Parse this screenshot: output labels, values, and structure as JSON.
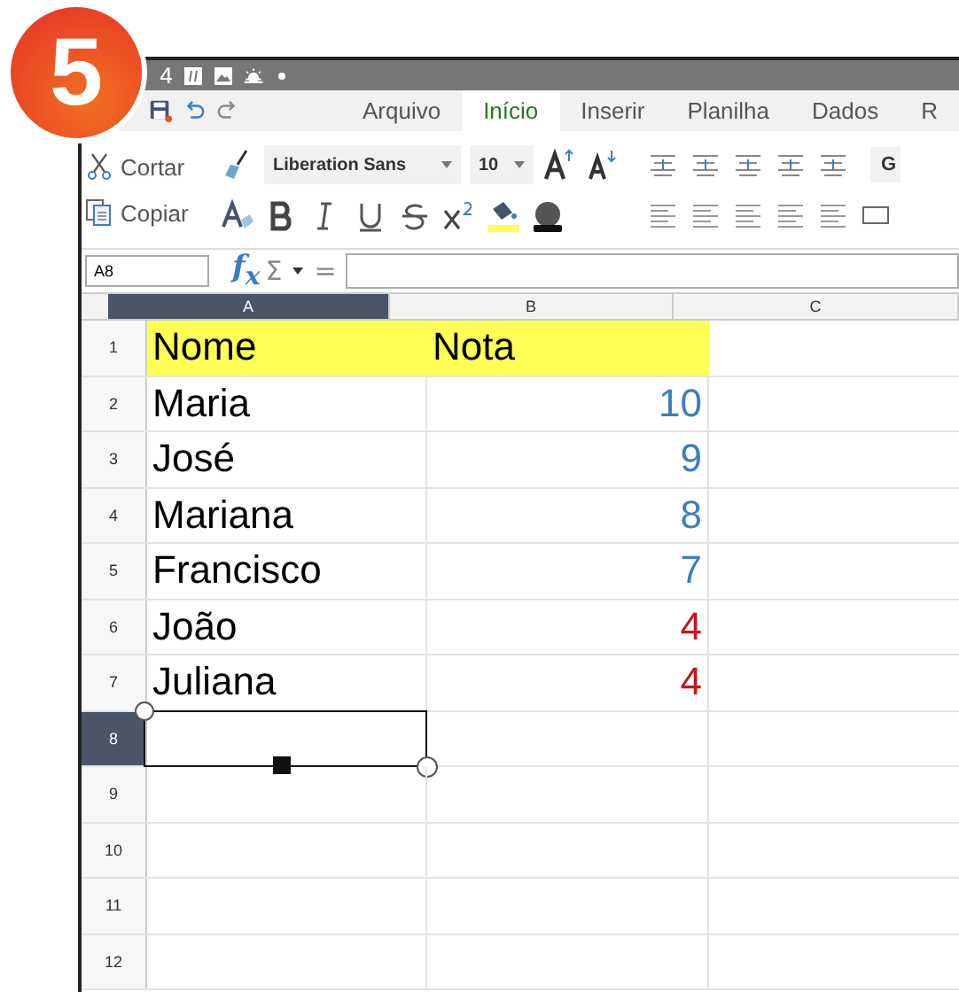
{
  "badge": {
    "text": "5"
  },
  "status_bar": {
    "text": "4"
  },
  "tabs": [
    {
      "label": "Arquivo",
      "selected": false
    },
    {
      "label": "Início",
      "selected": true
    },
    {
      "label": "Inserir",
      "selected": false
    },
    {
      "label": "Planilha",
      "selected": false
    },
    {
      "label": "Dados",
      "selected": false
    },
    {
      "label": "R",
      "selected": false
    }
  ],
  "toolbar": {
    "cut": "Cortar",
    "copy": "Copiar",
    "font": "Liberation Sans",
    "size": "10",
    "style_box": "G"
  },
  "formula_bar": {
    "name_box": "A8",
    "function": "f$_{x}$",
    "sum": "Σ",
    "equals": "="
  },
  "columns": [
    {
      "label": "A",
      "selected": true
    },
    {
      "label": "B",
      "selected": false
    },
    {
      "label": "C",
      "selected": false
    }
  ],
  "rows": [
    {
      "number": "1",
      "selected": false,
      "highlighted": true,
      "cells": [
        {
          "kind": "text",
          "text": "Nome"
        },
        {
          "kind": "text",
          "text": "Nota"
        }
      ]
    },
    {
      "number": "2",
      "selected": false,
      "highlighted": false,
      "cells": [
        {
          "kind": "text",
          "text": "Maria"
        },
        {
          "kind": "number",
          "text": "10",
          "color": "#3b7dc1"
        }
      ]
    },
    {
      "number": "3",
      "selected": false,
      "highlighted": false,
      "cells": [
        {
          "kind": "text",
          "text": "José"
        },
        {
          "kind": "number",
          "text": "9",
          "color": "#3b7dc1"
        }
      ]
    },
    {
      "number": "4",
      "selected": false,
      "highlighted": false,
      "cells": [
        {
          "kind": "text",
          "text": "Mariana"
        },
        {
          "kind": "number",
          "text": "8",
          "color": "#3b7dc1"
        }
      ]
    },
    {
      "number": "5",
      "selected": false,
      "highlighted": false,
      "cells": [
        {
          "kind": "text",
          "text": "Francisco"
        },
        {
          "kind": "number",
          "text": "7",
          "color": "#3b7dc1"
        }
      ]
    },
    {
      "number": "6",
      "selected": false,
      "highlighted": false,
      "cells": [
        {
          "kind": "text",
          "text": "João"
        },
        {
          "kind": "number",
          "text": "4",
          "color": "#c4161c"
        }
      ]
    },
    {
      "number": "7",
      "selected": false,
      "highlighted": false,
      "cells": [
        {
          "kind": "text",
          "text": "Juliana"
        },
        {
          "kind": "number",
          "text": "4",
          "color": "#c4161c"
        }
      ]
    },
    {
      "number": "8",
      "selected": true,
      "highlighted": false
    },
    {
      "number": "9",
      "selected": false,
      "highlighted": false
    },
    {
      "number": "10",
      "selected": false,
      "highlighted": false
    },
    {
      "number": "11",
      "selected": false,
      "highlighted": false
    },
    {
      "number": "12",
      "selected": false,
      "highlighted": false
    }
  ]
}
